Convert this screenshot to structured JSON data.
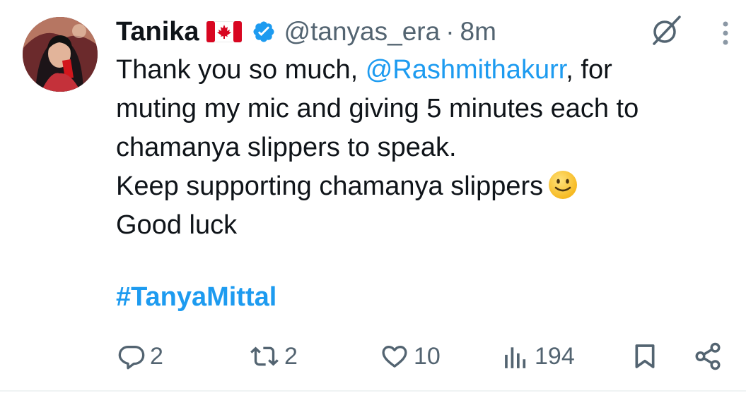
{
  "author": {
    "name": "Tanika",
    "handle": "@tanyas_era",
    "separator": "·",
    "time": "8m",
    "flag_icon": "canada-flag-icon",
    "verified_icon": "verified-badge-icon",
    "verified_color": "#1d9bf0"
  },
  "tweet": {
    "line1_pre": "Thank you so much, ",
    "mention": "@Rashmithakurr",
    "line1_post": ", for",
    "line2": "muting my mic and giving 5 minutes each to",
    "line3": "chamanya slippers to speak.",
    "line4": "Keep supporting chamanya slippers",
    "line4_emoji": "slightly-smiling-face-emoji",
    "line5": "Good luck",
    "hashtag": "#TanyaMittal"
  },
  "actions": {
    "replies": "2",
    "reposts": "2",
    "likes": "10",
    "views": "194"
  },
  "colors": {
    "link": "#1d9bf0",
    "text": "#0f1419",
    "secondary": "#536471"
  }
}
